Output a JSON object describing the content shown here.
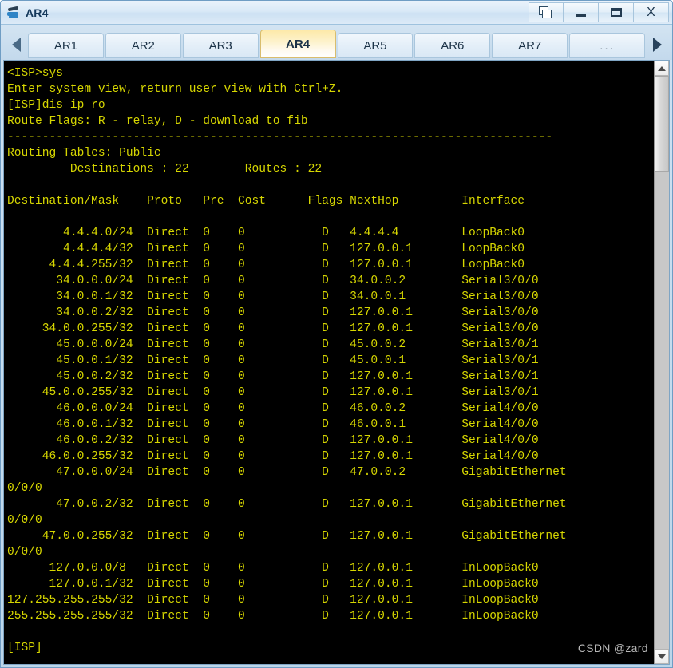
{
  "window": {
    "title": "AR4",
    "app_icon": "router-icon",
    "buttons": {
      "restore_windows": "restore-windows-icon",
      "minimize": "minimize-icon",
      "maximize": "maximize-icon",
      "close": "X"
    }
  },
  "tabbar": {
    "scroll_left": "scroll-left-arrow",
    "scroll_right": "scroll-right-arrow",
    "active_tab": "AR4",
    "tabs": [
      {
        "label": "AR1",
        "active": false
      },
      {
        "label": "AR2",
        "active": false
      },
      {
        "label": "AR3",
        "active": false
      },
      {
        "label": "AR4",
        "active": true
      },
      {
        "label": "AR5",
        "active": false
      },
      {
        "label": "AR6",
        "active": false
      },
      {
        "label": "AR7",
        "active": false
      },
      {
        "label": "...",
        "active": false
      }
    ]
  },
  "terminal": {
    "foreground_color": "#d6d600",
    "background_color": "#000000",
    "lines": [
      "<ISP>sys",
      "Enter system view, return user view with Ctrl+Z.",
      "[ISP]dis ip ro",
      "Route Flags: R - relay, D - download to fib",
      "------------------------------------------------------------------------------",
      "Routing Tables: Public",
      "         Destinations : 22        Routes : 22",
      "",
      "Destination/Mask    Proto   Pre  Cost      Flags NextHop         Interface",
      "",
      "        4.4.4.0/24  Direct  0    0           D   4.4.4.4         LoopBack0",
      "        4.4.4.4/32  Direct  0    0           D   127.0.0.1       LoopBack0",
      "      4.4.4.255/32  Direct  0    0           D   127.0.0.1       LoopBack0",
      "       34.0.0.0/24  Direct  0    0           D   34.0.0.2        Serial3/0/0",
      "       34.0.0.1/32  Direct  0    0           D   34.0.0.1        Serial3/0/0",
      "       34.0.0.2/32  Direct  0    0           D   127.0.0.1       Serial3/0/0",
      "     34.0.0.255/32  Direct  0    0           D   127.0.0.1       Serial3/0/0",
      "       45.0.0.0/24  Direct  0    0           D   45.0.0.2        Serial3/0/1",
      "       45.0.0.1/32  Direct  0    0           D   45.0.0.1        Serial3/0/1",
      "       45.0.0.2/32  Direct  0    0           D   127.0.0.1       Serial3/0/1",
      "     45.0.0.255/32  Direct  0    0           D   127.0.0.1       Serial3/0/1",
      "       46.0.0.0/24  Direct  0    0           D   46.0.0.2        Serial4/0/0",
      "       46.0.0.1/32  Direct  0    0           D   46.0.0.1        Serial4/0/0",
      "       46.0.0.2/32  Direct  0    0           D   127.0.0.1       Serial4/0/0",
      "     46.0.0.255/32  Direct  0    0           D   127.0.0.1       Serial4/0/0",
      "       47.0.0.0/24  Direct  0    0           D   47.0.0.2        GigabitEthernet",
      "0/0/0",
      "       47.0.0.2/32  Direct  0    0           D   127.0.0.1       GigabitEthernet",
      "0/0/0",
      "     47.0.0.255/32  Direct  0    0           D   127.0.0.1       GigabitEthernet",
      "0/0/0",
      "      127.0.0.0/8   Direct  0    0           D   127.0.0.1       InLoopBack0",
      "      127.0.0.1/32  Direct  0    0           D   127.0.0.1       InLoopBack0",
      "127.255.255.255/32  Direct  0    0           D   127.0.0.1       InLoopBack0",
      "255.255.255.255/32  Direct  0    0           D   127.0.0.1       InLoopBack0",
      "",
      "[ISP]"
    ],
    "watermark": "CSDN @zard__"
  },
  "scrollbar": {
    "up_arrow": "scroll-up-arrow",
    "down_arrow": "scroll-down-arrow"
  },
  "route_table": {
    "header": [
      "Destination/Mask",
      "Proto",
      "Pre",
      "Cost",
      "Flags",
      "NextHop",
      "Interface"
    ],
    "summary": {
      "destinations": "22",
      "routes": "22",
      "table": "Public"
    },
    "rows": [
      {
        "destination": "4.4.4.0/24",
        "proto": "Direct",
        "pre": "0",
        "cost": "0",
        "flags": "D",
        "nexthop": "4.4.4.4",
        "interface": "LoopBack0"
      },
      {
        "destination": "4.4.4.4/32",
        "proto": "Direct",
        "pre": "0",
        "cost": "0",
        "flags": "D",
        "nexthop": "127.0.0.1",
        "interface": "LoopBack0"
      },
      {
        "destination": "4.4.4.255/32",
        "proto": "Direct",
        "pre": "0",
        "cost": "0",
        "flags": "D",
        "nexthop": "127.0.0.1",
        "interface": "LoopBack0"
      },
      {
        "destination": "34.0.0.0/24",
        "proto": "Direct",
        "pre": "0",
        "cost": "0",
        "flags": "D",
        "nexthop": "34.0.0.2",
        "interface": "Serial3/0/0"
      },
      {
        "destination": "34.0.0.1/32",
        "proto": "Direct",
        "pre": "0",
        "cost": "0",
        "flags": "D",
        "nexthop": "34.0.0.1",
        "interface": "Serial3/0/0"
      },
      {
        "destination": "34.0.0.2/32",
        "proto": "Direct",
        "pre": "0",
        "cost": "0",
        "flags": "D",
        "nexthop": "127.0.0.1",
        "interface": "Serial3/0/0"
      },
      {
        "destination": "34.0.0.255/32",
        "proto": "Direct",
        "pre": "0",
        "cost": "0",
        "flags": "D",
        "nexthop": "127.0.0.1",
        "interface": "Serial3/0/0"
      },
      {
        "destination": "45.0.0.0/24",
        "proto": "Direct",
        "pre": "0",
        "cost": "0",
        "flags": "D",
        "nexthop": "45.0.0.2",
        "interface": "Serial3/0/1"
      },
      {
        "destination": "45.0.0.1/32",
        "proto": "Direct",
        "pre": "0",
        "cost": "0",
        "flags": "D",
        "nexthop": "45.0.0.1",
        "interface": "Serial3/0/1"
      },
      {
        "destination": "45.0.0.2/32",
        "proto": "Direct",
        "pre": "0",
        "cost": "0",
        "flags": "D",
        "nexthop": "127.0.0.1",
        "interface": "Serial3/0/1"
      },
      {
        "destination": "45.0.0.255/32",
        "proto": "Direct",
        "pre": "0",
        "cost": "0",
        "flags": "D",
        "nexthop": "127.0.0.1",
        "interface": "Serial3/0/1"
      },
      {
        "destination": "46.0.0.0/24",
        "proto": "Direct",
        "pre": "0",
        "cost": "0",
        "flags": "D",
        "nexthop": "46.0.0.2",
        "interface": "Serial4/0/0"
      },
      {
        "destination": "46.0.0.1/32",
        "proto": "Direct",
        "pre": "0",
        "cost": "0",
        "flags": "D",
        "nexthop": "46.0.0.1",
        "interface": "Serial4/0/0"
      },
      {
        "destination": "46.0.0.2/32",
        "proto": "Direct",
        "pre": "0",
        "cost": "0",
        "flags": "D",
        "nexthop": "127.0.0.1",
        "interface": "Serial4/0/0"
      },
      {
        "destination": "46.0.0.255/32",
        "proto": "Direct",
        "pre": "0",
        "cost": "0",
        "flags": "D",
        "nexthop": "127.0.0.1",
        "interface": "Serial4/0/0"
      },
      {
        "destination": "47.0.0.0/24",
        "proto": "Direct",
        "pre": "0",
        "cost": "0",
        "flags": "D",
        "nexthop": "47.0.0.2",
        "interface": "GigabitEthernet0/0/0"
      },
      {
        "destination": "47.0.0.2/32",
        "proto": "Direct",
        "pre": "0",
        "cost": "0",
        "flags": "D",
        "nexthop": "127.0.0.1",
        "interface": "GigabitEthernet0/0/0"
      },
      {
        "destination": "47.0.0.255/32",
        "proto": "Direct",
        "pre": "0",
        "cost": "0",
        "flags": "D",
        "nexthop": "127.0.0.1",
        "interface": "GigabitEthernet0/0/0"
      },
      {
        "destination": "127.0.0.0/8",
        "proto": "Direct",
        "pre": "0",
        "cost": "0",
        "flags": "D",
        "nexthop": "127.0.0.1",
        "interface": "InLoopBack0"
      },
      {
        "destination": "127.0.0.1/32",
        "proto": "Direct",
        "pre": "0",
        "cost": "0",
        "flags": "D",
        "nexthop": "127.0.0.1",
        "interface": "InLoopBack0"
      },
      {
        "destination": "127.255.255.255/32",
        "proto": "Direct",
        "pre": "0",
        "cost": "0",
        "flags": "D",
        "nexthop": "127.0.0.1",
        "interface": "InLoopBack0"
      },
      {
        "destination": "255.255.255.255/32",
        "proto": "Direct",
        "pre": "0",
        "cost": "0",
        "flags": "D",
        "nexthop": "127.0.0.1",
        "interface": "InLoopBack0"
      }
    ]
  }
}
